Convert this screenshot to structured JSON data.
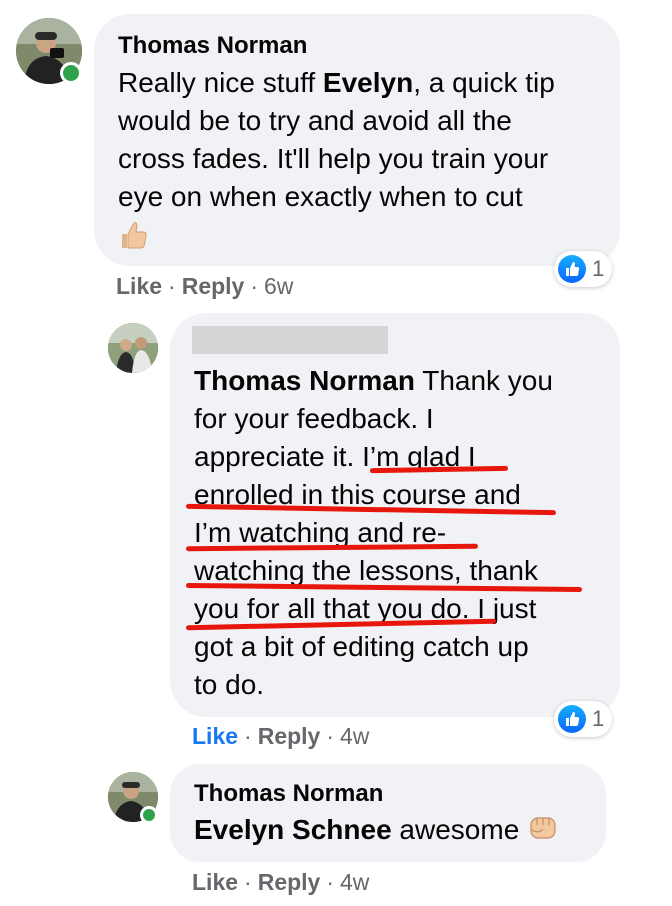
{
  "comments": [
    {
      "author": "Thomas Norman",
      "text_pre": "Really nice stuff ",
      "text_bold": "Evelyn",
      "text_rest_1": ", a quick tip",
      "lines": [
        "would be to try and avoid all the",
        "cross fades. It'll help you train your",
        "eye on when exactly when to cut"
      ],
      "emoji": "thumbs-up-emoji",
      "reaction_count": "1",
      "actions": {
        "like": "Like",
        "reply": "Reply",
        "time": "6w"
      }
    },
    {
      "author": "Thomas Norman",
      "text_after_name": " Thank you",
      "lines": [
        "for your feedback. I",
        "appreciate it. I’m glad I",
        "enrolled in this course and",
        "I’m watching and re-",
        "watching the lessons, thank",
        "you for all that you do. I just",
        "got a bit of editing catch up",
        "to do."
      ],
      "reaction_count": "1",
      "actions": {
        "like": "Like",
        "reply": "Reply",
        "time": "4w"
      }
    },
    {
      "author": "Thomas Norman",
      "mention": "Evelyn Schnee",
      "text": " awesome",
      "emoji": "fist-emoji",
      "actions": {
        "like": "Like",
        "reply": "Reply",
        "time": "4w"
      }
    }
  ],
  "separator": "·",
  "colors": {
    "bubble": "#f0f2f5",
    "meta": "#65676b",
    "liked": "#1877f2",
    "online": "#31a24c",
    "highlight": "#e8170d"
  }
}
